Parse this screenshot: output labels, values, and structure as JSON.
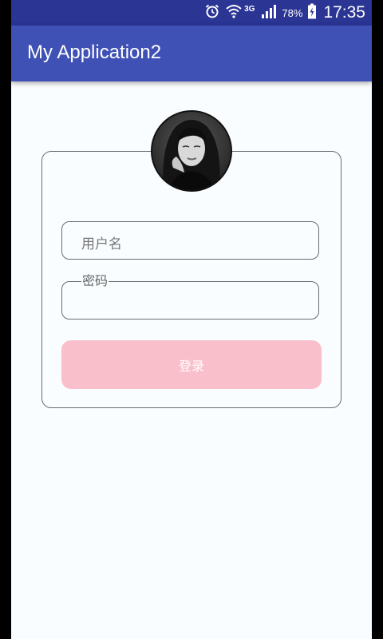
{
  "status_bar": {
    "network_type": "3G",
    "battery_percent": "78%",
    "time": "17:35"
  },
  "app_bar": {
    "title": "My Application2"
  },
  "login_form": {
    "username_placeholder": "用户名",
    "password_label": "密码",
    "login_button_label": "登录"
  },
  "colors": {
    "status_bar": "#2a3594",
    "app_bar": "#3f51b5",
    "login_button": "#f9bfcb",
    "background": "#fafdff"
  }
}
